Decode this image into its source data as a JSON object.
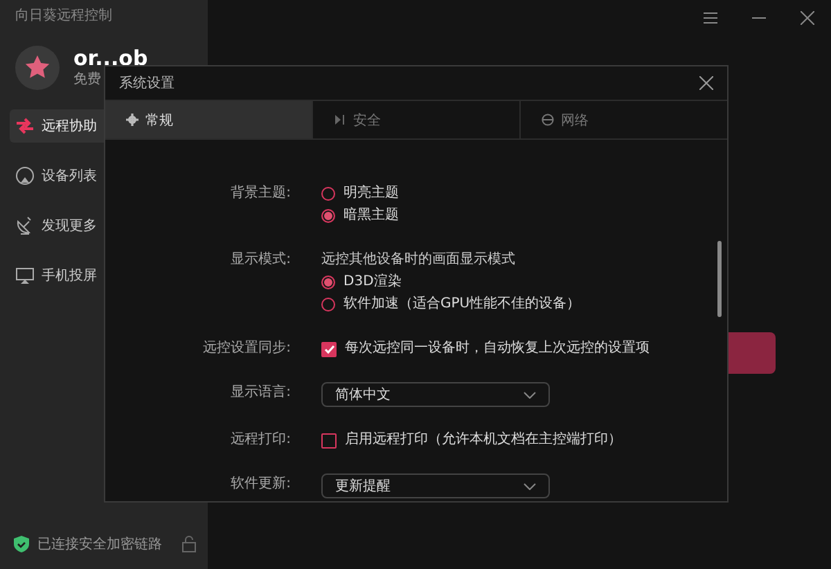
{
  "app": {
    "title": "向日葵远程控制"
  },
  "profile": {
    "name": "or...ob",
    "plan": "免费"
  },
  "sidebar": {
    "items": [
      {
        "label": "远程协助",
        "selected": true
      },
      {
        "label": "设备列表",
        "selected": false
      },
      {
        "label": "发现更多",
        "selected": false
      },
      {
        "label": "手机投屏",
        "selected": false
      }
    ]
  },
  "status_bar": {
    "text": "已连接安全加密链路"
  },
  "dialog": {
    "title": "系统设置",
    "tabs": [
      {
        "label": "常规",
        "selected": true
      },
      {
        "label": "安全",
        "selected": false
      },
      {
        "label": "网络",
        "selected": false
      }
    ],
    "settings": [
      {
        "kind": "radio",
        "label": "背景主题:",
        "options": [
          {
            "label": "明亮主题",
            "selected": false
          },
          {
            "label": "暗黑主题",
            "selected": true
          }
        ]
      },
      {
        "kind": "radio",
        "label": "显示模式:",
        "description": "远控其他设备时的画面显示模式",
        "options": [
          {
            "label": "D3D渲染",
            "selected": true
          },
          {
            "label": "软件加速（适合GPU性能不佳的设备）",
            "selected": false
          }
        ]
      },
      {
        "kind": "checkbox",
        "label": "远控设置同步:",
        "option": "每次远控同一设备时，自动恢复上次远控的设置项",
        "checked": true
      },
      {
        "kind": "dropdown",
        "label": "显示语言:",
        "value": "简体中文"
      },
      {
        "kind": "checkbox",
        "label": "远程打印:",
        "option": "启用远程打印（允许本机文档在主控端打印）",
        "checked": false
      },
      {
        "kind": "dropdown",
        "label": "软件更新:",
        "value": "更新提醒"
      }
    ]
  }
}
